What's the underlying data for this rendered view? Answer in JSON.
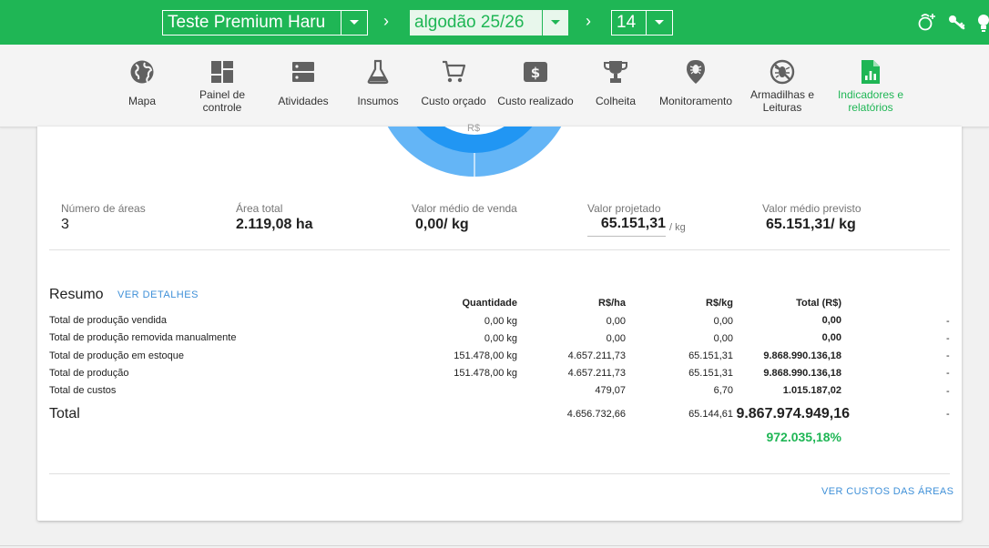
{
  "topbar": {
    "farm": "Teste Premium Haru",
    "crop": "algodão 25/26",
    "period": "14",
    "sep1": "›",
    "sep2": "›",
    "colors": {
      "bar": "#1fb655",
      "crop_bg": "#e8f7ec"
    },
    "icons": [
      "user-add-icon",
      "key-icon",
      "lightbulb-icon"
    ]
  },
  "nav": {
    "items": [
      {
        "label": "Mapa",
        "icon": "globe-icon"
      },
      {
        "label": "Painel de controle",
        "icon": "dashboard-icon"
      },
      {
        "label": "Atividades",
        "icon": "server-icon"
      },
      {
        "label": "Insumos",
        "icon": "flask-icon"
      },
      {
        "label": "Custo orçado",
        "icon": "cart-icon"
      },
      {
        "label": "Custo realizado",
        "icon": "money-icon"
      },
      {
        "label": "Colheita",
        "icon": "trophy-icon"
      },
      {
        "label": "Monitoramento",
        "icon": "pin-bug-icon"
      },
      {
        "label": "Armadilhas e Leituras",
        "icon": "no-bug-icon"
      },
      {
        "label": "Indicadores e relatórios",
        "icon": "report-icon",
        "active": true
      }
    ]
  },
  "chart": {
    "center_label": "R$"
  },
  "stats": {
    "num_areas_label": "Número de áreas",
    "num_areas_value": "3",
    "area_total_label": "Área total",
    "area_total_value": "2.119,08 ha",
    "valor_medio_venda_label": "Valor médio de venda",
    "valor_medio_venda_value": "0,00/ kg",
    "valor_projetado_label": "Valor projetado",
    "valor_projetado_value": "65.151,31",
    "valor_projetado_unit": "/ kg",
    "valor_medio_previsto_label": "Valor médio previsto",
    "valor_medio_previsto_value": "65.151,31/ kg"
  },
  "resumo": {
    "title": "Resumo",
    "ver_detalhes": "VER DETALHES",
    "headers": [
      "Quantidade",
      "R$/ha",
      "R$/kg",
      "Total (R$)"
    ],
    "rows": [
      {
        "label": "Total de produção vendida",
        "qtd": "0,00 kg",
        "ha": "0,00",
        "kg": "0,00",
        "total": "0,00",
        "dash": "-"
      },
      {
        "label": "Total de produção removida manualmente",
        "qtd": "0,00 kg",
        "ha": "0,00",
        "kg": "0,00",
        "total": "0,00",
        "dash": "-"
      },
      {
        "label": "Total de produção em estoque",
        "qtd": "151.478,00 kg",
        "ha": "4.657.211,73",
        "kg": "65.151,31",
        "total": "9.868.990.136,18",
        "dash": "-"
      },
      {
        "label": "Total de produção",
        "qtd": "151.478,00 kg",
        "ha": "4.657.211,73",
        "kg": "65.151,31",
        "total": "9.868.990.136,18",
        "dash": "-"
      },
      {
        "label": "Total de custos",
        "qtd": "",
        "ha": "479,07",
        "kg": "6,70",
        "total": "1.015.187,02",
        "dash": "-"
      }
    ],
    "total": {
      "label": "Total",
      "ha": "4.656.732,66",
      "kg": "65.144,61",
      "value": "9.867.974.949,16",
      "dash": "-",
      "percent": "972.035,18%"
    },
    "ver_custos": "VER CUSTOS DAS ÁREAS"
  }
}
